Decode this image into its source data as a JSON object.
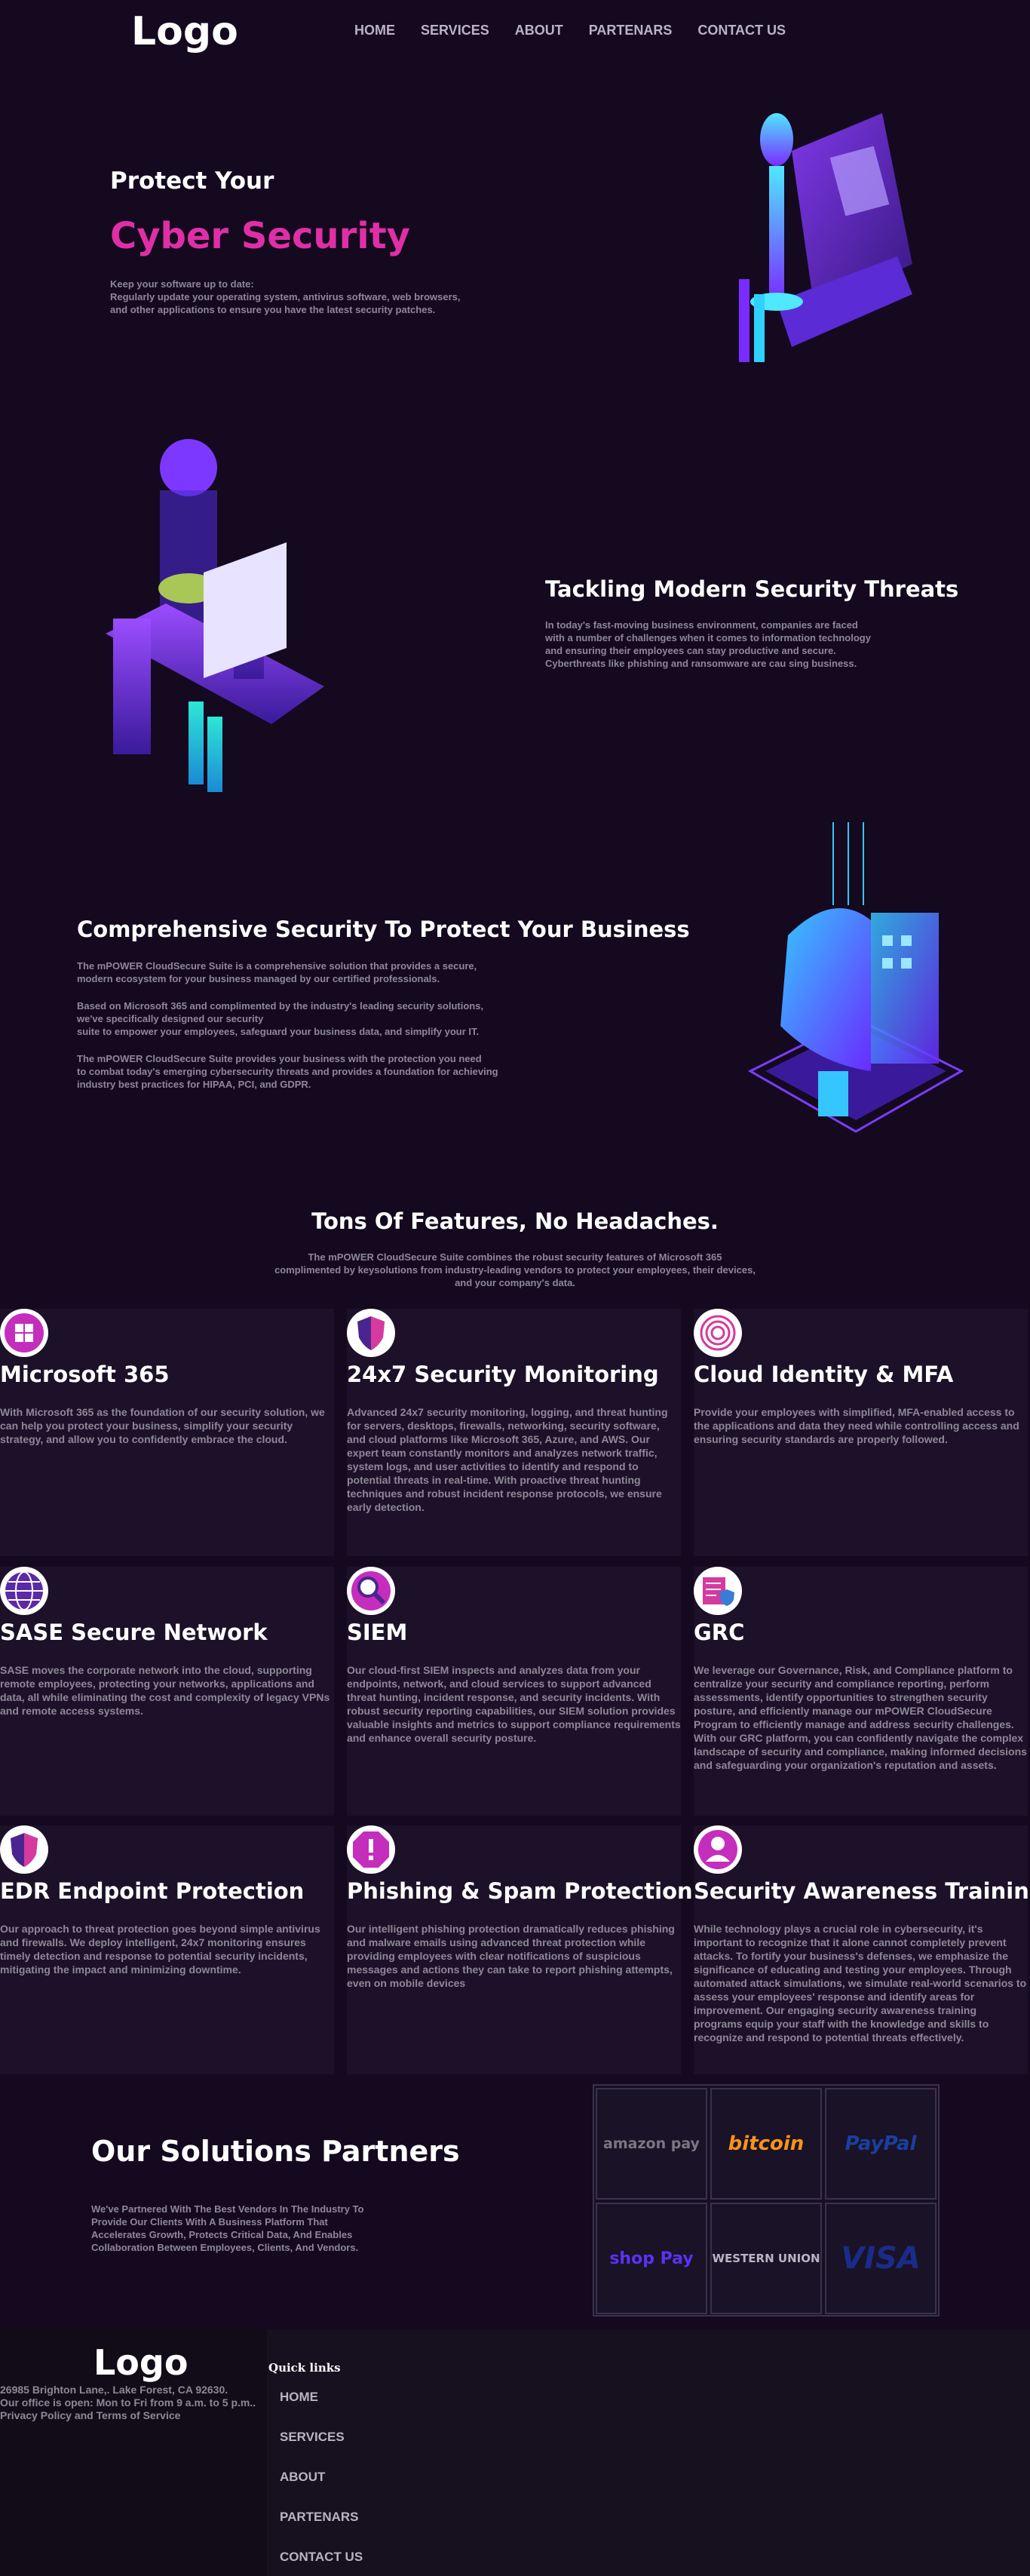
{
  "header": {
    "logo": "Logo",
    "nav": [
      "HOME",
      "SERVICES",
      "ABOUT",
      "PARTENARS",
      "CONTACT US"
    ]
  },
  "hero": {
    "line1": "Protect Your",
    "line2": "Cyber Security",
    "desc1": "Keep your software up to date:",
    "desc2": "Regularly update your operating system, antivirus software, web browsers,",
    "desc3": "and other applications to ensure you have the latest security patches."
  },
  "section2": {
    "title": "Tackling Modern Security Threats",
    "lines": [
      "In today's fast-moving business environment, companies are faced",
      "with a number of challenges when it comes to information technology",
      "and ensuring their employees can stay productive and secure.",
      "Cyberthreats like phishing and ransomware are cau sing business."
    ]
  },
  "section3": {
    "title": "Comprehensive Security To Protect Your Business",
    "p1": [
      "The mPOWER CloudSecure Suite is a comprehensive solution that provides a secure,",
      "modern ecosystem for your business managed by our certified professionals."
    ],
    "p2": [
      "Based on Microsoft 365 and complimented by the industry's leading security solutions,",
      "we've specifically designed our security",
      "suite to empower your employees, safeguard your business data, and simplify your IT."
    ],
    "p3": [
      "The mPOWER CloudSecure Suite provides your business with the protection you need",
      "to combat today's emerging cybersecurity threats and provides a foundation for achieving",
      "industry best practices for HIPAA, PCI, and GDPR."
    ]
  },
  "features": {
    "title": "Tons Of Features, No Headaches.",
    "lines": [
      "The mPOWER CloudSecure Suite combines the robust security features of Microsoft 365",
      "complimented by keysolutions from industry-leading vendors to protect your employees, their devices,",
      "and your company's data."
    ],
    "cards": [
      {
        "icon": "windows-icon",
        "title": "Microsoft 365",
        "text": "With Microsoft 365 as the foundation of our security solution, we can help you protect your business, simplify your security strategy, and allow you to confidently embrace the cloud."
      },
      {
        "icon": "shield-icon",
        "title": "24x7 Security Monitoring",
        "text": "Advanced 24x7 security monitoring, logging, and threat hunting for servers, desktops, firewalls, networking, security software, and cloud platforms like Microsoft 365, Azure, and AWS. Our expert team constantly monitors and analyzes network traffic, system logs, and user activities to identify and respond to potential threats in real-time. With proactive threat hunting techniques and robust incident response protocols, we ensure early detection."
      },
      {
        "icon": "fingerprint-icon",
        "title": "Cloud Identity & MFA",
        "text": "Provide your employees with simplified, MFA-enabled access to the applications and data they need while controlling access and ensuring security standards are properly followed."
      },
      {
        "icon": "globe-icon",
        "title": "SASE Secure Network",
        "text": "SASE moves the corporate network into the cloud, supporting remote employees, protecting your networks, applications and data, all while eliminating the cost and complexity of legacy VPNs and remote access systems."
      },
      {
        "icon": "magnifier-icon",
        "title": "SIEM",
        "text": "Our cloud-first SIEM inspects and analyzes data from your endpoints, network, and cloud services to support advanced threat hunting, incident response, and security incidents. With robust security reporting capabilities, our SIEM solution provides valuable insights and metrics to support compliance requirements and enhance overall security posture."
      },
      {
        "icon": "checklist-shield-icon",
        "title": "GRC",
        "text": "We leverage our Governance, Risk, and Compliance platform to centralize your security and compliance reporting, perform assessments, identify opportunities to strengthen security posture, and efficiently manage our mPOWER CloudSecure Program to efficiently manage and address security challenges. With our GRC platform, you can confidently navigate the complex landscape of security and compliance, making informed decisions and safeguarding your organization's reputation and assets."
      },
      {
        "icon": "shield-icon",
        "title": "EDR Endpoint Protection",
        "text": "Our approach to threat protection goes beyond simple antivirus and firewalls. We deploy intelligent, 24x7 monitoring ensures timely detection and response to potential security incidents, mitigating the impact and minimizing downtime."
      },
      {
        "icon": "warning-icon",
        "title": "Phishing & Spam Protection",
        "text": "Our intelligent phishing protection dramatically reduces phishing and malware emails using advanced threat protection while providing employees with clear notifications of suspicious messages and actions they can take to report phishing attempts, even on mobile devices"
      },
      {
        "icon": "user-icon",
        "title": "Security Awareness Training",
        "text": "While technology plays a crucial role in cybersecurity, it's important to recognize that it alone cannot completely prevent attacks. To fortify your business's defenses, we emphasize the significance of educating and testing your employees. Through automated attack simulations, we simulate real-world scenarios to assess your employees' response and identify areas for improvement. Our engaging security awareness training programs equip your staff with the knowledge and skills to recognize and respond to potential threats effectively."
      }
    ]
  },
  "partners": {
    "title": "Our Solutions Partners",
    "lines": [
      "We've Partnered With The Best Vendors In The Industry To",
      "Provide Our Clients With A Business Platform That",
      "Accelerates Growth, Protects Critical Data, And Enables",
      "Collaboration Between Employees, Clients, And Vendors."
    ],
    "logos": [
      "amazon pay",
      "bitcoin",
      "PayPal",
      "shop Pay",
      "WESTERN UNION",
      "VISA"
    ]
  },
  "footer": {
    "logo": "Logo",
    "address": "26985 Brighton Lane,. Lake Forest, CA 92630.",
    "hours": "Our office is open: Mon to Fri from 9 a.m. to 5 p.m..",
    "policy": "Privacy Policy and Terms of Service",
    "quick_title": "Quick links",
    "links": [
      "HOME",
      "SERVICES",
      "ABOUT",
      "PARTENARS",
      "CONTACT US"
    ]
  }
}
